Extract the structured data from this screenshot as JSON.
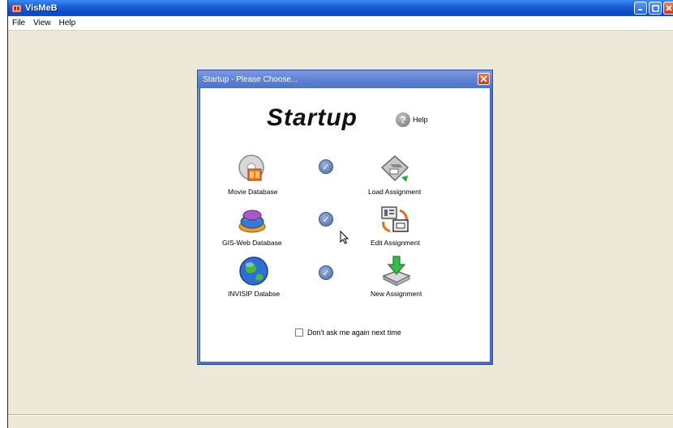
{
  "app": {
    "title": "VisMeB"
  },
  "menu": {
    "items": [
      "File",
      "View",
      "Help"
    ]
  },
  "dialog": {
    "title": "Startup - Please Choose...",
    "heading": "Startup",
    "help_label": "Help",
    "options": [
      {
        "label": "Movie Database",
        "icon": "movie-database-icon",
        "checked": true
      },
      {
        "label": "GIS-Web Database",
        "icon": "gis-web-database-icon",
        "checked": true
      },
      {
        "label": "INVISIP Databse",
        "icon": "globe-icon",
        "checked": true
      },
      {
        "label": "Load Assignment",
        "icon": "load-assignment-icon"
      },
      {
        "label": "Edit Assignment",
        "icon": "edit-assignment-icon"
      },
      {
        "label": "New Assignment",
        "icon": "new-assignment-icon"
      }
    ],
    "dont_ask_label": "Don't ask me again next time",
    "dont_ask_checked": false
  },
  "colors": {
    "titlebar": "#0b4ac6",
    "client_bg": "#ece9d8",
    "dialog_frame": "#4a6fc4",
    "close_red": "#c23a1c"
  }
}
